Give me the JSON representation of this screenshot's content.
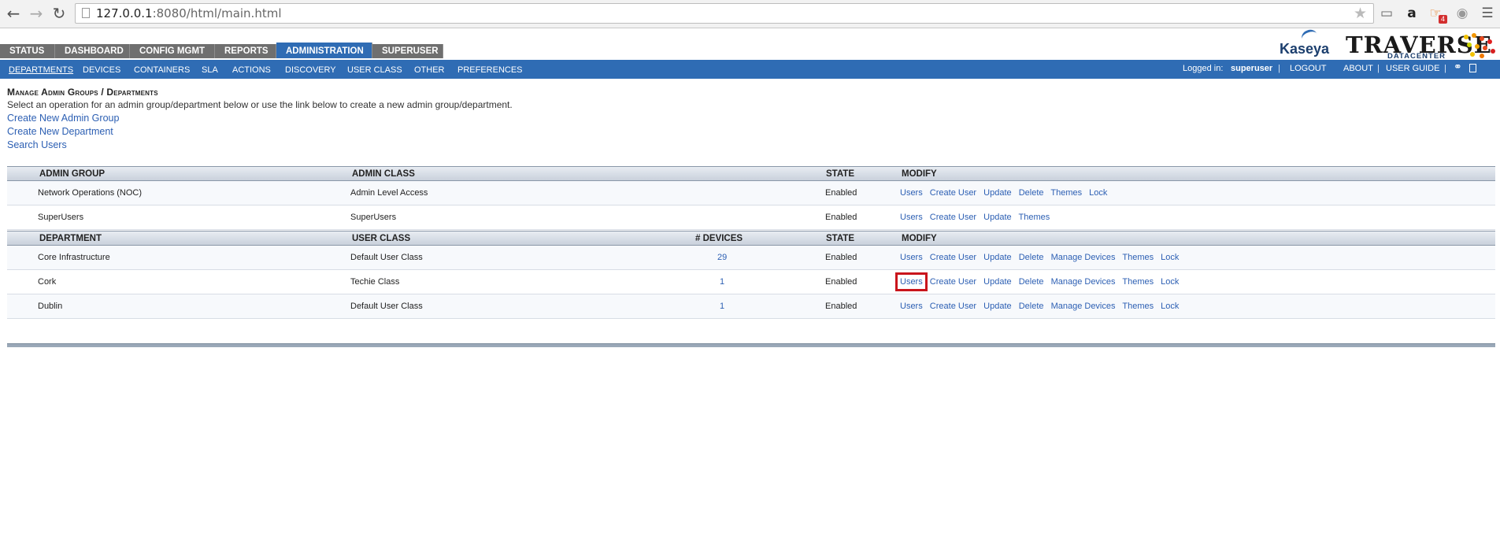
{
  "browser": {
    "url_host": "127.0.0.1",
    "url_rest": ":8080/html/main.html",
    "rss_badge": "4"
  },
  "tabs": [
    {
      "label": "STATUS"
    },
    {
      "label": "DASHBOARD"
    },
    {
      "label": "CONFIG MGMT"
    },
    {
      "label": "REPORTS"
    },
    {
      "label": "ADMINISTRATION",
      "active": true
    },
    {
      "label": "SUPERUSER"
    }
  ],
  "logo": {
    "kaseya": "Kaseya",
    "traverse": "TRAVERSE",
    "datacenter": "DATACENTER"
  },
  "subnav": {
    "items": [
      "DEPARTMENTS",
      "DEVICES",
      "CONTAINERS",
      "SLA",
      "ACTIONS",
      "DISCOVERY",
      "USER CLASS",
      "OTHER",
      "PREFERENCES"
    ],
    "logged_in_label": "Logged in:",
    "username": "superuser",
    "logout": "LOGOUT",
    "about": "ABOUT",
    "user_guide": "USER GUIDE"
  },
  "page": {
    "title": "Manage Admin Groups / Departments",
    "description": "Select an operation for an admin group/department below or use the link below to create a new admin group/department.",
    "links": [
      "Create New Admin Group",
      "Create New Department",
      "Search Users"
    ]
  },
  "admin_table": {
    "headers": {
      "name": "ADMIN GROUP",
      "class": "ADMIN CLASS",
      "state": "STATE",
      "modify": "MODIFY"
    },
    "rows": [
      {
        "name": "Network Operations (NOC)",
        "class": "Admin Level Access",
        "state": "Enabled",
        "actions": [
          "Users",
          "Create User",
          "Update",
          "Delete",
          "Themes",
          "Lock"
        ]
      },
      {
        "name": "SuperUsers",
        "class": "SuperUsers",
        "state": "Enabled",
        "actions": [
          "Users",
          "Create User",
          "Update",
          "Themes"
        ]
      }
    ]
  },
  "dept_table": {
    "headers": {
      "name": "DEPARTMENT",
      "class": "USER CLASS",
      "devices": "# DEVICES",
      "state": "STATE",
      "modify": "MODIFY"
    },
    "rows": [
      {
        "name": "Core Infrastructure",
        "class": "Default User Class",
        "devices": "29",
        "state": "Enabled",
        "actions": [
          "Users",
          "Create User",
          "Update",
          "Delete",
          "Manage Devices",
          "Themes",
          "Lock"
        ]
      },
      {
        "name": "Cork",
        "class": "Techie Class",
        "devices": "1",
        "state": "Enabled",
        "actions": [
          "Users",
          "Create User",
          "Update",
          "Delete",
          "Manage Devices",
          "Themes",
          "Lock"
        ]
      },
      {
        "name": "Dublin",
        "class": "Default User Class",
        "devices": "1",
        "state": "Enabled",
        "actions": [
          "Users",
          "Create User",
          "Update",
          "Delete",
          "Manage Devices",
          "Themes",
          "Lock"
        ]
      }
    ]
  },
  "colors": {
    "nav_blue": "#2f6cb4",
    "tab_gray": "#6f6f6f",
    "link_blue": "#2c5fb3",
    "highlight_red": "#c9151c"
  }
}
